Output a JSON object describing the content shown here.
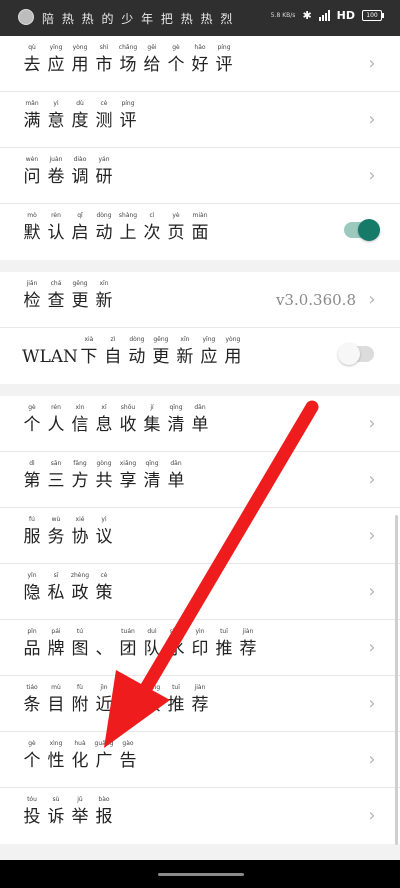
{
  "status_bar": {
    "title": "陪 热 热 的 少 年 把 热 热 烈",
    "speed": "5.8 KB/s",
    "network": "HD",
    "battery": "100"
  },
  "groups": [
    {
      "rows": [
        {
          "chars": [
            [
              "qù",
              "去"
            ],
            [
              "yīng",
              "应"
            ],
            [
              "yòng",
              "用"
            ],
            [
              "shì",
              "市"
            ],
            [
              "chǎng",
              "场"
            ],
            [
              "gěi",
              "给"
            ],
            [
              "gè",
              "个"
            ],
            [
              "hǎo",
              "好"
            ],
            [
              "píng",
              "评"
            ]
          ],
          "accessory": "chevron"
        },
        {
          "chars": [
            [
              "mǎn",
              "满"
            ],
            [
              "yì",
              "意"
            ],
            [
              "dù",
              "度"
            ],
            [
              "cè",
              "测"
            ],
            [
              "píng",
              "评"
            ]
          ],
          "accessory": "chevron"
        },
        {
          "chars": [
            [
              "wèn",
              "问"
            ],
            [
              "juàn",
              "卷"
            ],
            [
              "diào",
              "调"
            ],
            [
              "yán",
              "研"
            ]
          ],
          "accessory": "chevron"
        },
        {
          "chars": [
            [
              "mò",
              "默"
            ],
            [
              "rèn",
              "认"
            ],
            [
              "qǐ",
              "启"
            ],
            [
              "dòng",
              "动"
            ],
            [
              "shàng",
              "上"
            ],
            [
              "cì",
              "次"
            ],
            [
              "yè",
              "页"
            ],
            [
              "miàn",
              "面"
            ]
          ],
          "accessory": "toggle",
          "toggle_on": true
        }
      ]
    },
    {
      "rows": [
        {
          "chars": [
            [
              "jiǎn",
              "检"
            ],
            [
              "chá",
              "查"
            ],
            [
              "gēng",
              "更"
            ],
            [
              "xīn",
              "新"
            ]
          ],
          "accessory": "version",
          "version": "v3.0.360.8"
        },
        {
          "prefix": "WLAN",
          "chars": [
            [
              "xià",
              "下"
            ],
            [
              "zì",
              "自"
            ],
            [
              "dòng",
              "动"
            ],
            [
              "gēng",
              "更"
            ],
            [
              "xīn",
              "新"
            ],
            [
              "yīng",
              "应"
            ],
            [
              "yòng",
              "用"
            ]
          ],
          "accessory": "toggle",
          "toggle_on": false
        }
      ]
    },
    {
      "rows": [
        {
          "chars": [
            [
              "gè",
              "个"
            ],
            [
              "rén",
              "人"
            ],
            [
              "xìn",
              "信"
            ],
            [
              "xī",
              "息"
            ],
            [
              "shōu",
              "收"
            ],
            [
              "jí",
              "集"
            ],
            [
              "qīng",
              "清"
            ],
            [
              "dān",
              "单"
            ]
          ],
          "accessory": "chevron"
        },
        {
          "chars": [
            [
              "dì",
              "第"
            ],
            [
              "sān",
              "三"
            ],
            [
              "fāng",
              "方"
            ],
            [
              "gòng",
              "共"
            ],
            [
              "xiǎng",
              "享"
            ],
            [
              "qīng",
              "清"
            ],
            [
              "dān",
              "单"
            ]
          ],
          "accessory": "chevron"
        },
        {
          "chars": [
            [
              "fú",
              "服"
            ],
            [
              "wù",
              "务"
            ],
            [
              "xié",
              "协"
            ],
            [
              "yì",
              "议"
            ]
          ],
          "accessory": "chevron"
        },
        {
          "chars": [
            [
              "yǐn",
              "隐"
            ],
            [
              "sī",
              "私"
            ],
            [
              "zhèng",
              "政"
            ],
            [
              "cè",
              "策"
            ]
          ],
          "accessory": "chevron"
        },
        {
          "chars": [
            [
              "pǐn",
              "品"
            ],
            [
              "pái",
              "牌"
            ],
            [
              "tú",
              "图"
            ],
            [
              "",
              "、"
            ],
            [
              "tuán",
              "团"
            ],
            [
              "duì",
              "队"
            ],
            [
              "shuǐ",
              "水"
            ],
            [
              "yìn",
              "印"
            ],
            [
              "tuī",
              "推"
            ],
            [
              "jiàn",
              "荐"
            ]
          ],
          "accessory": "chevron"
        },
        {
          "chars": [
            [
              "tiáo",
              "条"
            ],
            [
              "mù",
              "目"
            ],
            [
              "fù",
              "附"
            ],
            [
              "jìn",
              "近"
            ],
            [
              "xuǎn",
              "选"
            ],
            [
              "xiàng",
              "项"
            ],
            [
              "tuī",
              "推"
            ],
            [
              "jiàn",
              "荐"
            ]
          ],
          "accessory": "chevron"
        },
        {
          "chars": [
            [
              "gè",
              "个"
            ],
            [
              "xìng",
              "性"
            ],
            [
              "huà",
              "化"
            ],
            [
              "guǎng",
              "广"
            ],
            [
              "gào",
              "告"
            ]
          ],
          "accessory": "chevron"
        },
        {
          "chars": [
            [
              "tóu",
              "投"
            ],
            [
              "sù",
              "诉"
            ],
            [
              "jǔ",
              "举"
            ],
            [
              "bào",
              "报"
            ]
          ],
          "accessory": "chevron"
        }
      ]
    }
  ],
  "colors": {
    "accent": "#157a68",
    "annotation_arrow": "#ee1c1c"
  }
}
